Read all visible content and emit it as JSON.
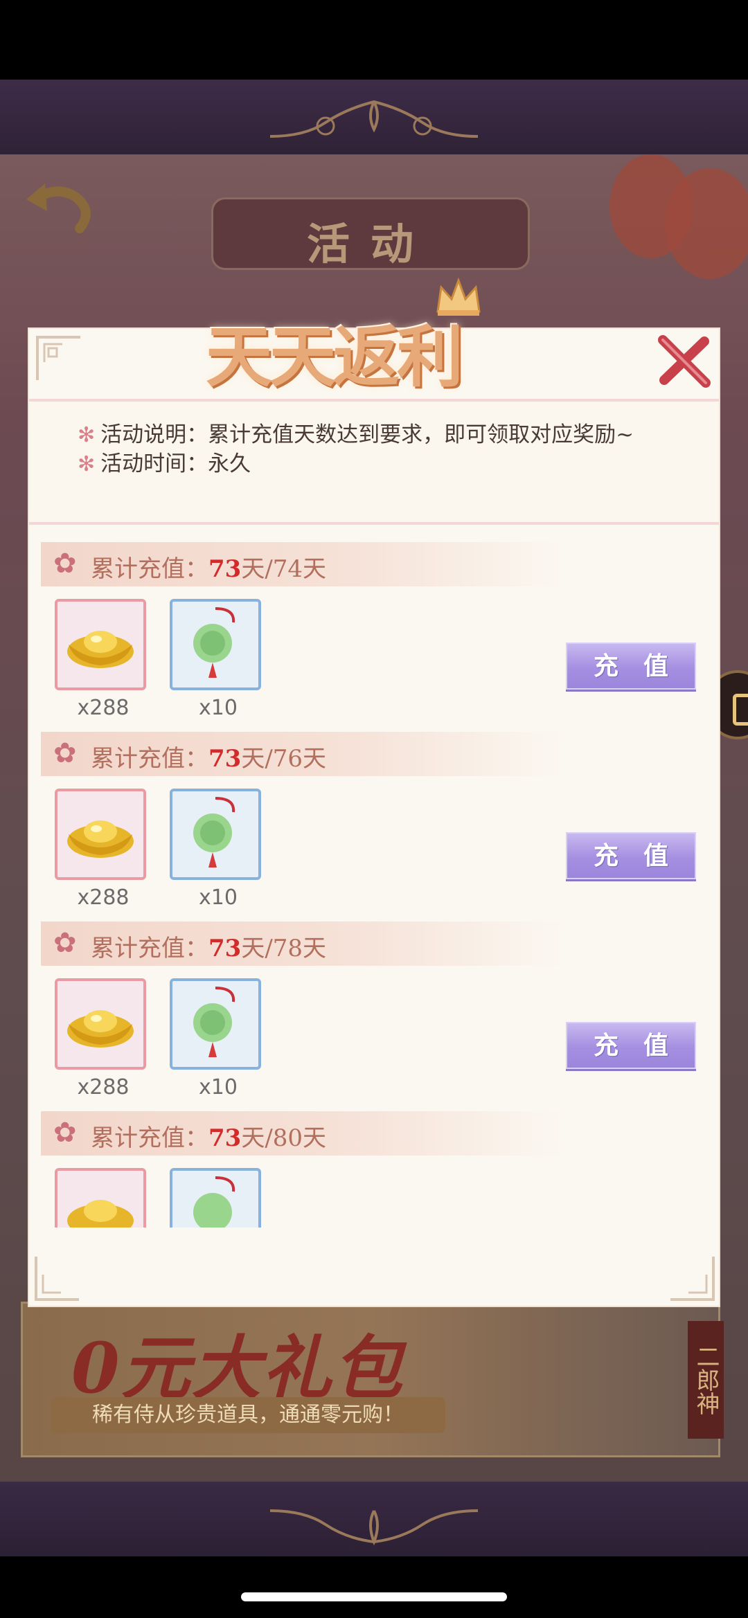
{
  "background": {
    "page_title": "活动",
    "promo": {
      "title": "0元大礼包",
      "subtitle": "稀有侍从珍贵道具，通通零元购！",
      "tag": "二郎神"
    }
  },
  "modal": {
    "title": "天天返利",
    "description": {
      "rule_label": "活动说明：",
      "rule_text": "累计充值天数达到要求，即可领取对应奖励~",
      "time_label": "活动时间：",
      "time_text": "永久"
    },
    "sections": [
      {
        "label": "累计充值：",
        "current": "73",
        "target": "天/74天",
        "rewards": [
          {
            "icon": "gold-ingot-icon",
            "qty": "x288"
          },
          {
            "icon": "jade-charm-icon",
            "qty": "x10"
          }
        ],
        "button": "充值"
      },
      {
        "label": "累计充值：",
        "current": "73",
        "target": "天/76天",
        "rewards": [
          {
            "icon": "gold-ingot-icon",
            "qty": "x288"
          },
          {
            "icon": "jade-charm-icon",
            "qty": "x10"
          }
        ],
        "button": "充值"
      },
      {
        "label": "累计充值：",
        "current": "73",
        "target": "天/78天",
        "rewards": [
          {
            "icon": "gold-ingot-icon",
            "qty": "x288"
          },
          {
            "icon": "jade-charm-icon",
            "qty": "x10"
          }
        ],
        "button": "充值"
      },
      {
        "label": "累计充值：",
        "current": "73",
        "target": "天/80天",
        "rewards": [
          {
            "icon": "gold-ingot-icon",
            "qty": ""
          },
          {
            "icon": "jade-charm-icon",
            "qty": ""
          }
        ],
        "button": ""
      }
    ]
  },
  "colors": {
    "accent_purple": "#a58fe1",
    "highlight_red": "#d22b2b",
    "section_text": "#b26f5e"
  }
}
